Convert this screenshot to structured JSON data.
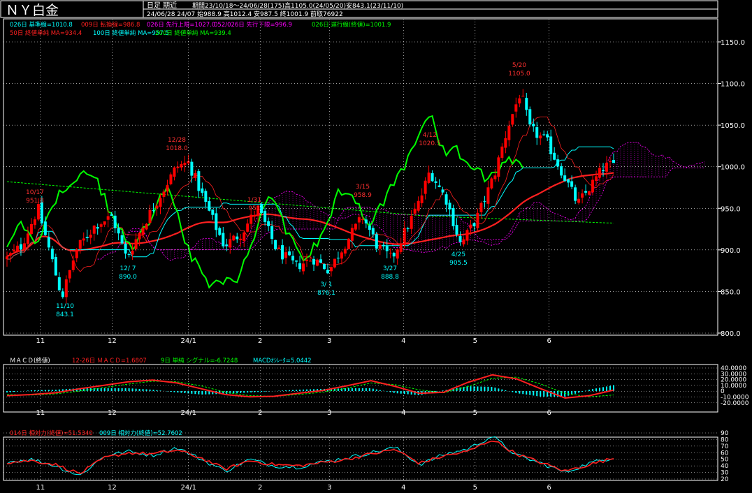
{
  "header": {
    "title": "ＮＹ白金",
    "period_label": "日足 期近",
    "stats_line1": "期間23/10/18～24/06/28(175)高1105.0(24/05/20)安843.1(23/11/10)",
    "stats_line2": "24/06/28 24/07 始988.9 高1012.4 安987.5 終1001.9 前取76922"
  },
  "legend": {
    "row1": [
      {
        "text": "026日 基準線=1010.8",
        "color": "#00ffff"
      },
      {
        "text": "009日 転換線=986.8",
        "color": "#ff2020"
      },
      {
        "text": "026日 先行上限=1027.0",
        "color": "#ff00ff"
      },
      {
        "text": "052/026日 先行下限=996.9",
        "color": "#ff00ff"
      },
      {
        "text": "026日 遅行線(終値)=1001.9",
        "color": "#00ff00"
      }
    ],
    "row2": [
      {
        "text": "50日 終値単純 MA=934.4",
        "color": "#ff2020"
      },
      {
        "text": "100日 終値単純 MA=957.5",
        "color": "#00ffff"
      },
      {
        "text": "200日 終値単純 MA=939.4",
        "color": "#00ff00"
      }
    ]
  },
  "macd_legend": [
    {
      "text": "ＭＡＣＤ(終値)",
      "color": "#ffffff"
    },
    {
      "text": "12-26日 ＭＡＣＤ=1.6807",
      "color": "#ff2020"
    },
    {
      "text": "9日 単純 シグナル=-6.7248",
      "color": "#00ff00"
    },
    {
      "text": "MACDｵｼﾚｰﾀ=5.0442",
      "color": "#00ffff"
    }
  ],
  "rsi_legend": [
    {
      "text": "014日 相対力(終値)=51.5340",
      "color": "#ff2020"
    },
    {
      "text": "009日 相対力(終値)=52.7602",
      "color": "#00ffff"
    }
  ],
  "colors": {
    "up": "#ff0000",
    "down": "#00ffff",
    "grid": "#ffffff",
    "kijun": "#00ffff",
    "tenkan": "#ff2020",
    "cloud": "#ff00ff",
    "chikou": "#00ff00",
    "ma50": "#ff2020",
    "ma100": "#00ffff",
    "ma200": "#00ff00",
    "macd": "#ff2020",
    "signal": "#00ff00",
    "osc": "#00ffff",
    "rsi14": "#ff2020",
    "rsi9": "#00ffff"
  },
  "chart_data": [
    {
      "type": "candlestick",
      "x_tick_labels": [
        "11",
        "12",
        "24/1",
        "2",
        "3",
        "4",
        "5",
        "6"
      ],
      "ylim": [
        800,
        1150
      ],
      "y_ticks": [
        800,
        850,
        900,
        950,
        1000,
        1050,
        1100,
        1150
      ],
      "y_tick_labels": [
        "800.0",
        "850.0",
        "900.0",
        "950.0",
        "1000.0",
        "1050.0",
        "1100.0",
        "1150.0"
      ],
      "close_path": [
        {
          "d": "2023-10-18",
          "v": 890
        },
        {
          "d": "2023-10-24",
          "v": 905
        },
        {
          "d": "2023-10-31",
          "v": 950
        },
        {
          "d": "2023-11-10",
          "v": 843
        },
        {
          "d": "2023-11-16",
          "v": 900
        },
        {
          "d": "2023-11-24",
          "v": 930
        },
        {
          "d": "2023-12-01",
          "v": 940
        },
        {
          "d": "2023-12-07",
          "v": 890
        },
        {
          "d": "2023-12-15",
          "v": 935
        },
        {
          "d": "2023-12-22",
          "v": 970
        },
        {
          "d": "2023-12-28",
          "v": 1000
        },
        {
          "d": "2024-01-02",
          "v": 1005
        },
        {
          "d": "2024-01-10",
          "v": 950
        },
        {
          "d": "2024-01-17",
          "v": 905
        },
        {
          "d": "2024-01-24",
          "v": 920
        },
        {
          "d": "2024-01-31",
          "v": 950
        },
        {
          "d": "2024-02-08",
          "v": 900
        },
        {
          "d": "2024-02-16",
          "v": 880
        },
        {
          "d": "2024-02-23",
          "v": 890
        },
        {
          "d": "2024-03-01",
          "v": 876
        },
        {
          "d": "2024-03-08",
          "v": 910
        },
        {
          "d": "2024-03-15",
          "v": 940
        },
        {
          "d": "2024-03-21",
          "v": 905
        },
        {
          "d": "2024-03-27",
          "v": 889
        },
        {
          "d": "2024-04-03",
          "v": 930
        },
        {
          "d": "2024-04-08",
          "v": 960
        },
        {
          "d": "2024-04-12",
          "v": 995
        },
        {
          "d": "2024-04-19",
          "v": 960
        },
        {
          "d": "2024-04-25",
          "v": 906
        },
        {
          "d": "2024-05-02",
          "v": 940
        },
        {
          "d": "2024-05-09",
          "v": 990
        },
        {
          "d": "2024-05-15",
          "v": 1050
        },
        {
          "d": "2024-05-20",
          "v": 1090
        },
        {
          "d": "2024-05-24",
          "v": 1045
        },
        {
          "d": "2024-05-31",
          "v": 1030
        },
        {
          "d": "2024-06-07",
          "v": 990
        },
        {
          "d": "2024-06-13",
          "v": 955
        },
        {
          "d": "2024-06-18",
          "v": 975
        },
        {
          "d": "2024-06-24",
          "v": 1000
        },
        {
          "d": "2024-06-28",
          "v": 1001.9
        }
      ],
      "annotations": [
        {
          "date": "10/17",
          "value": "951.8",
          "kind": "high"
        },
        {
          "date": "11/10",
          "value": "843.1",
          "kind": "low"
        },
        {
          "date": "12/ 7",
          "value": "890.0",
          "kind": "low"
        },
        {
          "date": "12/28",
          "value": "1018.0",
          "kind": "high"
        },
        {
          "date": "1/31",
          "value": "951",
          "kind": "high"
        },
        {
          "date": "3/ 1",
          "value": "876.1",
          "kind": "low"
        },
        {
          "date": "3/15",
          "value": "958.9",
          "kind": "high"
        },
        {
          "date": "3/27",
          "value": "888.8",
          "kind": "low"
        },
        {
          "date": "4/12",
          "value": "1020.5",
          "kind": "high"
        },
        {
          "date": "4/25",
          "value": "905.5",
          "kind": "low"
        },
        {
          "date": "5/20",
          "value": "1105.0",
          "kind": "high"
        }
      ]
    },
    {
      "type": "line",
      "title": "ＭＡＣＤ(終値)",
      "ylim": [
        -20,
        40
      ],
      "y_tick_labels": [
        "40.0000",
        "30.0000",
        "20.0000",
        "10.0000",
        "0",
        "-10.0000",
        "-20.0000"
      ],
      "series": [
        {
          "name": "12-26日 ＭＡＣＤ",
          "values": [
            -8,
            -6,
            -3,
            4,
            10,
            16,
            19,
            14,
            4,
            -6,
            -10,
            -9,
            -4,
            1,
            9,
            18,
            8,
            -4,
            -2,
            15,
            28,
            21,
            4,
            -12,
            -8,
            1.7
          ]
        },
        {
          "name": "9日 単純 シグナル",
          "values": [
            -6,
            -7,
            -5,
            0,
            6,
            12,
            17,
            16,
            9,
            -2,
            -8,
            -9,
            -6,
            -2,
            5,
            14,
            11,
            2,
            -3,
            8,
            22,
            24,
            12,
            -4,
            -10,
            -6.7
          ]
        }
      ]
    },
    {
      "type": "line",
      "title": "相対力",
      "ylim": [
        20,
        90
      ],
      "y_tick_labels": [
        "90",
        "80",
        "70",
        "60",
        "50",
        "40",
        "30",
        "20"
      ],
      "series": [
        {
          "name": "014日 相対力(終値)",
          "values": [
            45,
            48,
            42,
            28,
            52,
            60,
            58,
            64,
            52,
            35,
            48,
            42,
            40,
            45,
            50,
            58,
            65,
            44,
            55,
            62,
            80,
            58,
            45,
            32,
            42,
            51.5
          ]
        },
        {
          "name": "009日 相対力(終値)",
          "values": [
            46,
            50,
            40,
            25,
            55,
            62,
            56,
            68,
            50,
            32,
            50,
            40,
            38,
            46,
            52,
            60,
            68,
            42,
            57,
            66,
            85,
            56,
            44,
            30,
            44,
            52.8
          ]
        }
      ]
    }
  ]
}
